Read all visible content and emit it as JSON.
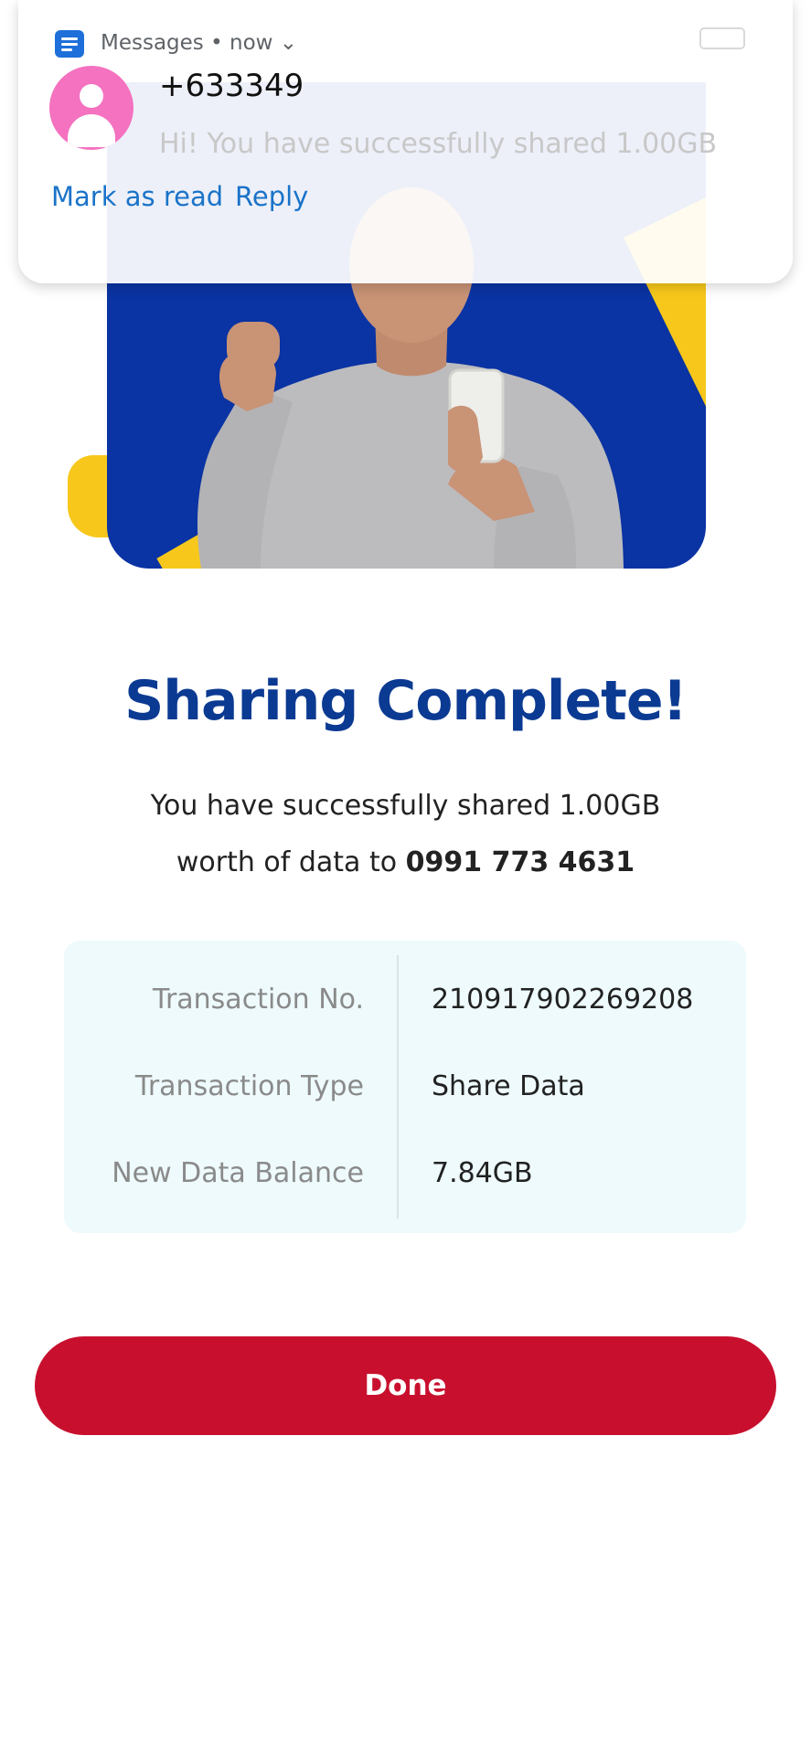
{
  "notification": {
    "app_name": "Messages",
    "time": "now",
    "sender": "+633349",
    "preview": "Hi! You have successfully shared 1.00GB",
    "actions": [
      "Mark as read",
      "Reply"
    ]
  },
  "main": {
    "title": "Sharing Complete!",
    "message_line1": "You have successfully shared 1.00GB",
    "message_line2_prefix": "worth of data to",
    "message_line2_number": "0991 773 4631",
    "details": [
      {
        "label": "Transaction No.",
        "value": "210917902269208"
      },
      {
        "label": "Transaction Type",
        "value": "Share Data"
      },
      {
        "label": "New Data Balance",
        "value": "7.84GB"
      }
    ],
    "done_label": "Done"
  },
  "colors": {
    "title_blue": "#0b3a92",
    "hero_blue": "#0a33a3",
    "hero_yellow": "#f7c81b",
    "done_red": "#c8102e",
    "link_blue": "#1a73c8",
    "avatar_pink": "#f472c0",
    "details_bg": "#eefafc"
  }
}
